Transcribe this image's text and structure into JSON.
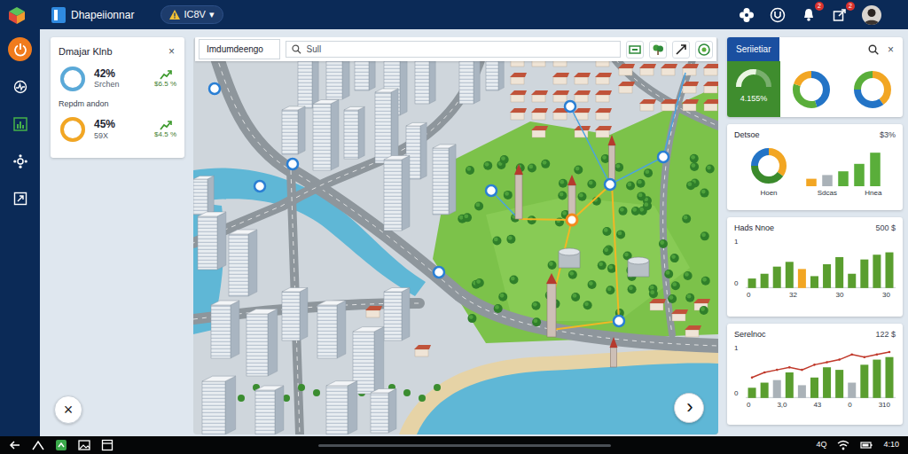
{
  "app": {
    "title": "Dhapeiionnar",
    "selector": {
      "label": "IC8V",
      "caret": "▾"
    },
    "notifications": [
      {
        "badge": "2"
      },
      {
        "badge": "2"
      }
    ]
  },
  "sidebar": {
    "items": [
      {
        "selected": true
      },
      {
        "selected": false
      },
      {
        "selected": false
      },
      {
        "selected": false
      },
      {
        "selected": false
      }
    ]
  },
  "summary": {
    "title": "Dmajar Klnb",
    "close": "×",
    "blocks": [
      {
        "metrics": [
          {
            "value": "42%",
            "label": "Srchen",
            "trend": "$6.5 %",
            "level": 1,
            "color": "#5aa9d8"
          }
        ]
      },
      {
        "heading": "Repdm andon",
        "metrics": [
          {
            "value": "45%",
            "label": "59X",
            "trend": "$4.5 %",
            "level": 1,
            "color": "#f2a623"
          }
        ]
      }
    ]
  },
  "actions": {
    "close": "×",
    "next": "›"
  },
  "map": {
    "title": "Imdumdeengo",
    "search": {
      "placeholder": "Sull"
    }
  },
  "panel": {
    "tab": {
      "label": "Seriietiar",
      "selected": true
    },
    "close": "×",
    "gauge": {
      "value": "4.155%",
      "level": 0.55
    },
    "donuts": [
      {
        "segments": [
          {
            "value": 45,
            "color": "#2374c6"
          },
          {
            "value": 35,
            "color": "#5aae3a"
          },
          {
            "value": 20,
            "color": "#f2a623"
          }
        ]
      },
      {
        "segments": [
          {
            "value": 40,
            "color": "#f2a623"
          },
          {
            "value": 35,
            "color": "#2374c6"
          },
          {
            "value": 25,
            "color": "#5aae3a"
          }
        ]
      }
    ],
    "cards": [
      {
        "kind": "donut-bars",
        "title": "Detsoe",
        "value": "$3%",
        "donut": {
          "label": "Hoen",
          "segments": [
            {
              "value": 35,
              "color": "#f2a623"
            },
            {
              "value": 40,
              "color": "#3b8a2c"
            },
            {
              "value": 25,
              "color": "#2374c6"
            }
          ]
        },
        "bars": [
          {
            "value": 2,
            "color": "#f2a623"
          },
          {
            "value": 3,
            "color": "#aab2b8"
          },
          {
            "value": 4,
            "color": "#5aae3a"
          },
          {
            "value": 6,
            "color": "#5aae3a"
          },
          {
            "value": 9,
            "color": "#5aae3a"
          }
        ],
        "x_ticks": [
          "Sdcas",
          "Hnea"
        ]
      },
      {
        "kind": "bars",
        "title": "Hads Nnoe",
        "value": "500 $",
        "y_ticks": [
          "1",
          "0"
        ],
        "x_ticks": [
          "0",
          "32",
          "30",
          "30"
        ],
        "bars": [
          {
            "value": 2,
            "color": "#5a9e2f"
          },
          {
            "value": 3,
            "color": "#5a9e2f"
          },
          {
            "value": 4.5,
            "color": "#5a9e2f"
          },
          {
            "value": 5.5,
            "color": "#5a9e2f"
          },
          {
            "value": 4,
            "color": "#f2a623"
          },
          {
            "value": 2.5,
            "color": "#5a9e2f"
          },
          {
            "value": 5,
            "color": "#5a9e2f"
          },
          {
            "value": 6.5,
            "color": "#5a9e2f"
          },
          {
            "value": 3,
            "color": "#5a9e2f"
          },
          {
            "value": 6,
            "color": "#5a9e2f"
          },
          {
            "value": 7,
            "color": "#5a9e2f"
          },
          {
            "value": 7.5,
            "color": "#5a9e2f"
          }
        ]
      },
      {
        "kind": "combo",
        "title": "Serelnoc",
        "value": "122 $",
        "y_ticks": [
          "1",
          "0"
        ],
        "x_ticks": [
          "0",
          "3,0",
          "43",
          "0",
          "310"
        ],
        "bars": [
          {
            "value": 2,
            "color": "#5a9e2f"
          },
          {
            "value": 3,
            "color": "#5a9e2f"
          },
          {
            "value": 3.5,
            "color": "#aab2b8"
          },
          {
            "value": 5,
            "color": "#5a9e2f"
          },
          {
            "value": 2.5,
            "color": "#aab2b8"
          },
          {
            "value": 4,
            "color": "#5a9e2f"
          },
          {
            "value": 6,
            "color": "#5a9e2f"
          },
          {
            "value": 5.5,
            "color": "#5a9e2f"
          },
          {
            "value": 3,
            "color": "#aab2b8"
          },
          {
            "value": 6.5,
            "color": "#5a9e2f"
          },
          {
            "value": 7.5,
            "color": "#5a9e2f"
          },
          {
            "value": 8,
            "color": "#5a9e2f"
          }
        ],
        "line": [
          4,
          5,
          5.5,
          6,
          5.5,
          6.5,
          7,
          7.5,
          8.5,
          8,
          8.5,
          9
        ]
      }
    ]
  },
  "status_bar": {
    "left": "4Q",
    "clock": "4:10"
  }
}
